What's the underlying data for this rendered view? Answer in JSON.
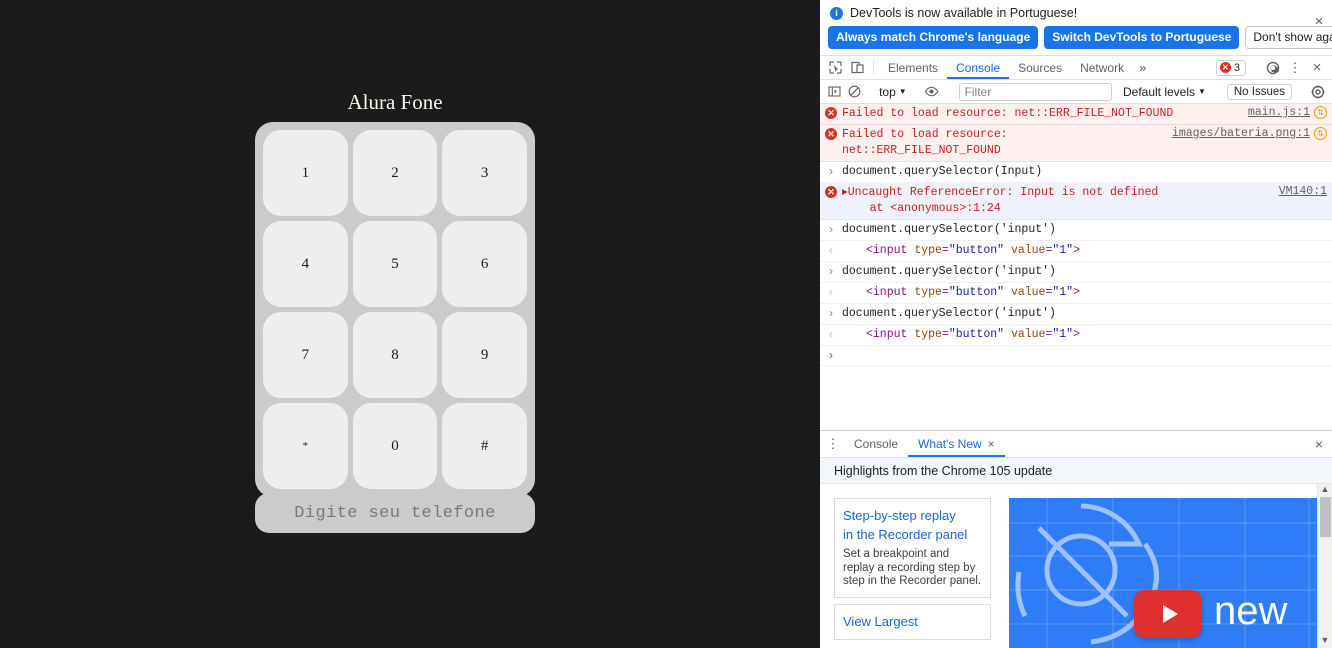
{
  "page": {
    "title": "Alura Fone",
    "keys": [
      "1",
      "2",
      "3",
      "4",
      "5",
      "6",
      "7",
      "8",
      "9",
      "*",
      "0",
      "#"
    ],
    "display_value": "",
    "display_placeholder": "Digite seu telefone",
    "background_color": "#1b1b1b",
    "keypad_color": "#cbcbcb",
    "key_color": "#eeeeee"
  },
  "devtools": {
    "banner": {
      "info_icon": "info-icon",
      "message": "DevTools is now available in Portuguese!",
      "primary_button": "Always match Chrome's language",
      "secondary_button": "Switch DevTools to Portuguese",
      "dismiss_button": "Don't show again",
      "close_icon": "×",
      "accent_color": "#1a73e8"
    },
    "toolbar": {
      "inspect_icon": "inspect-element-icon",
      "device_icon": "device-toolbar-icon",
      "tabs": [
        {
          "label": "Elements",
          "active": false
        },
        {
          "label": "Console",
          "active": true
        },
        {
          "label": "Sources",
          "active": false
        },
        {
          "label": "Network",
          "active": false
        }
      ],
      "more_tabs_icon": "»",
      "error_count": "3",
      "error_badge_color": "#d93025",
      "settings_icon": "gear-icon",
      "kebab_icon": "⋮",
      "close_icon": "×"
    },
    "filterbar": {
      "sidebar_icon": "console-sidebar-icon",
      "clear_icon": "clear-console-icon",
      "context": "top",
      "eye_icon": "live-expression-icon",
      "filter_value": "",
      "filter_placeholder": "Filter",
      "levels": "Default levels",
      "issues": "No Issues",
      "settings_icon": "gear-icon"
    },
    "console": [
      {
        "kind": "error",
        "gutter": "error-icon",
        "text": "Failed to load resource: net::ERR_FILE_NOT_FOUND",
        "source": "main.js:1",
        "badge": "network-request-icon"
      },
      {
        "kind": "error",
        "gutter": "error-icon",
        "text": "Failed to load resource:\nnet::ERR_FILE_NOT_FOUND",
        "source": "images/bateria.png:1",
        "badge": "network-request-icon"
      },
      {
        "kind": "command",
        "gutter": "input-arrow",
        "text": "document.querySelector(Input)"
      },
      {
        "kind": "exception",
        "gutter": "error-icon",
        "expand": "▶",
        "text": "Uncaught ReferenceError: Input is not defined\n    at <anonymous>:1:24",
        "source": "VM140:1"
      },
      {
        "kind": "command",
        "gutter": "input-arrow",
        "text": "document.querySelector('input')"
      },
      {
        "kind": "response",
        "gutter": "output-arrow",
        "html": [
          "<input ",
          "type",
          "=",
          "\"button\"",
          " ",
          "value",
          "=",
          "\"1\"",
          ">"
        ]
      },
      {
        "kind": "command",
        "gutter": "input-arrow",
        "text": "document.querySelector('input')"
      },
      {
        "kind": "response",
        "gutter": "output-arrow",
        "html": [
          "<input ",
          "type",
          "=",
          "\"button\"",
          " ",
          "value",
          "=",
          "\"1\"",
          ">"
        ]
      },
      {
        "kind": "command",
        "gutter": "input-arrow",
        "text": "document.querySelector('input')"
      },
      {
        "kind": "response",
        "gutter": "output-arrow",
        "html": [
          "<input ",
          "type",
          "=",
          "\"button\"",
          " ",
          "value",
          "=",
          "\"1\"",
          ">"
        ]
      },
      {
        "kind": "prompt",
        "gutter": "input-arrow",
        "text": ""
      }
    ],
    "drawer": {
      "kebab_icon": "⋮",
      "tabs": [
        {
          "label": "Console",
          "active": false,
          "closable": false
        },
        {
          "label": "What's New",
          "active": true,
          "closable": true,
          "close_icon": "×"
        }
      ],
      "close_icon": "×",
      "whats_new": {
        "header": "Highlights from the Chrome 105 update",
        "cards": [
          {
            "title_line1": "Step-by-step replay",
            "title_line2": "in the Recorder panel",
            "description": "Set a breakpoint and replay a recording step by step in the Recorder panel."
          },
          {
            "title_line1": "View Largest",
            "title_line2": "",
            "description": ""
          }
        ],
        "media_label": "new",
        "media_color": "#2f7df6",
        "play_button_color": "#e02f2f"
      },
      "scrollbar": {
        "up_arrow": "▲",
        "down_arrow": "▼"
      }
    }
  }
}
